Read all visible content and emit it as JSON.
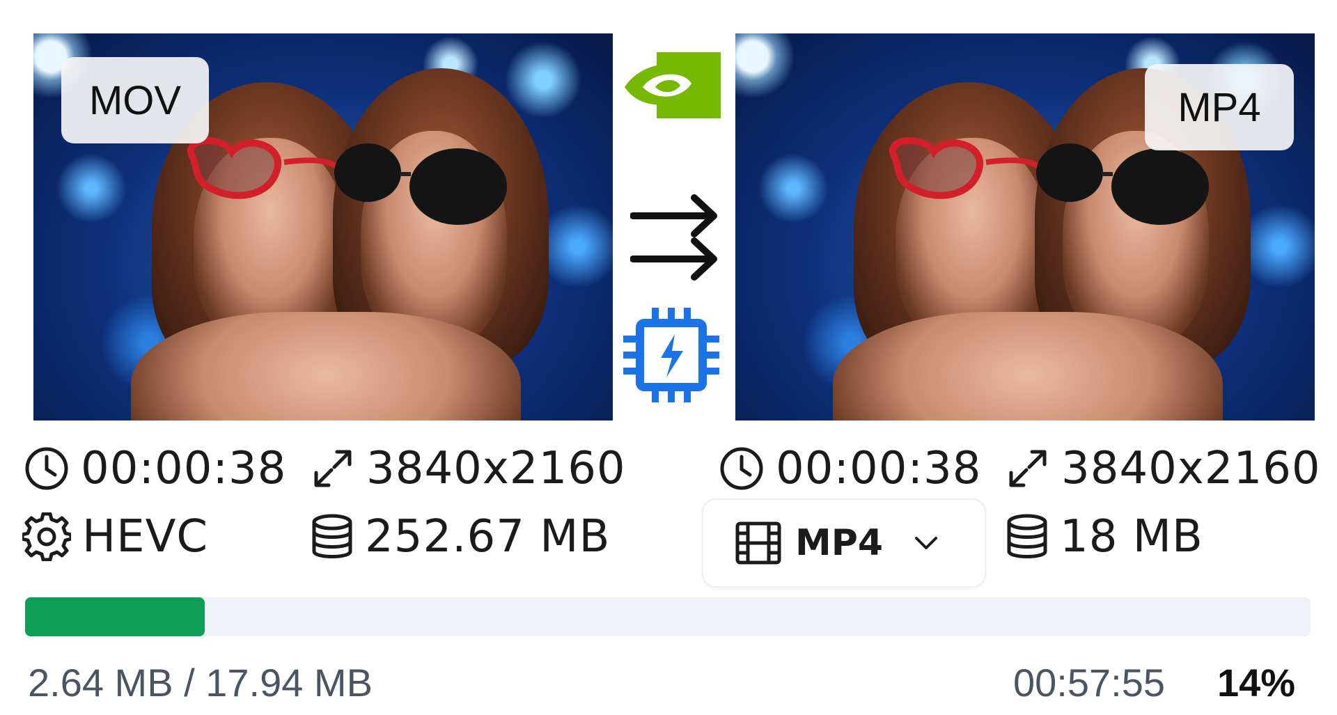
{
  "source": {
    "format_badge": "MOV",
    "duration": "00:00:38",
    "resolution": "3840x2160",
    "codec": "HEVC",
    "size": "252.67 MB"
  },
  "output": {
    "format_badge": "MP4",
    "duration": "00:00:38",
    "resolution": "3840x2160",
    "format_select": "MP4",
    "size": "18 MB"
  },
  "progress": {
    "bytes": "2.64 MB / 17.94 MB",
    "time_remaining": "00:57:55",
    "percent_label": "14%",
    "fraction": 0.14
  },
  "icons": [
    "clock-icon",
    "resize-icon",
    "gear-icon",
    "database-icon",
    "film-icon",
    "chevron-down-icon",
    "nvidia-logo",
    "double-arrow-icon",
    "cpu-bolt-icon"
  ],
  "colors": {
    "progress_fill": "#0f9e58",
    "progress_track": "#eef1f6",
    "nvidia_green": "#76b900",
    "chip_blue": "#1a73e8"
  }
}
